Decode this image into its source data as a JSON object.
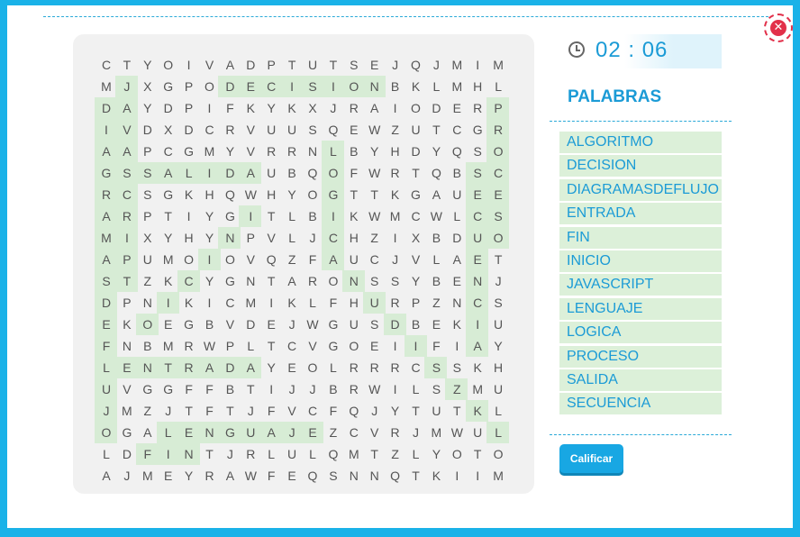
{
  "timer": "02 : 06",
  "words_title": "PALABRAS",
  "words": [
    "ALGORITMO",
    "DECISION",
    "DIAGRAMASDEFLUJO",
    "ENTRADA",
    "FIN",
    "INICIO",
    "JAVASCRIPT",
    "LENGUAJE",
    "LOGICA",
    "PROCESO",
    "SALIDA",
    "SECUENCIA"
  ],
  "button": "Calificar",
  "close_icon": "close-icon",
  "grid": [
    "CTYOIVADPTUTSEJQJMIM",
    "MJXGPODECISIONBKLMHL",
    "DAYDPIFKYKXJRAIODERP",
    "IVDXDCRVUUSQEWZUTCGR",
    "AAPCGMYVRRNLBYHDYQSO",
    "GSSALIDAUBQOFWRTQBSC",
    "RCSGKHQWHYOGTTKGAUEE",
    "ARPTIYGITLBIKWMCWLCS",
    "MIXYHYNPVLJCHZIXBDUO",
    "APUMOIOVQZFAUCJVLAET",
    "STZKCYGNTARONSSYBENJ",
    "DPNIKICMIKLFHURPZNCS",
    "EKOEGBVDEJWGUSDBEKIU",
    "FNBMRWPLTCVGOEIIFIAY",
    "LENTRADAYEOLRRRCSSKH",
    "UVGGFFBTIJJBRWILSZMU",
    "JMZJTFTJFVCFQJYTUTKL",
    "OGALENGUAJEZCVRJMWUL",
    "LDFINTJRLULQMTZLYOTO",
    "AJMEYRAWFEQSNNQTKIIM"
  ],
  "found": [
    {
      "word": "DECISION",
      "start": [
        1,
        6
      ],
      "dir": [
        0,
        1
      ],
      "len": 8
    },
    {
      "word": "SALIDA",
      "start": [
        5,
        2
      ],
      "dir": [
        0,
        1
      ],
      "len": 6
    },
    {
      "word": "ENTRADA",
      "start": [
        14,
        1
      ],
      "dir": [
        0,
        1
      ],
      "len": 7
    },
    {
      "word": "LENGUAJE",
      "start": [
        17,
        3
      ],
      "dir": [
        0,
        1
      ],
      "len": 8
    },
    {
      "word": "FIN",
      "start": [
        18,
        2
      ],
      "dir": [
        0,
        1
      ],
      "len": 3
    },
    {
      "word": "JAVASCRIPT",
      "start": [
        1,
        1
      ],
      "dir": [
        1,
        0
      ],
      "len": 10
    },
    {
      "word": "DIAGRAMASDEFLUJO",
      "start": [
        2,
        0
      ],
      "dir": [
        1,
        0
      ],
      "len": 16
    },
    {
      "word": "PROCESO",
      "start": [
        2,
        19
      ],
      "dir": [
        1,
        0
      ],
      "len": 7
    },
    {
      "word": "SECUENCIA",
      "start": [
        5,
        18
      ],
      "dir": [
        1,
        0
      ],
      "len": 9
    },
    {
      "word": "LOGICA",
      "start": [
        4,
        11
      ],
      "dir": [
        1,
        0
      ],
      "len": 6
    },
    {
      "word": "ALGORITMO",
      "start": [
        9,
        11
      ],
      "dir": [
        1,
        1
      ],
      "len": 9
    },
    {
      "word": "INICIO",
      "start": [
        7,
        7
      ],
      "dir": [
        1,
        -1
      ],
      "len": 6
    }
  ]
}
